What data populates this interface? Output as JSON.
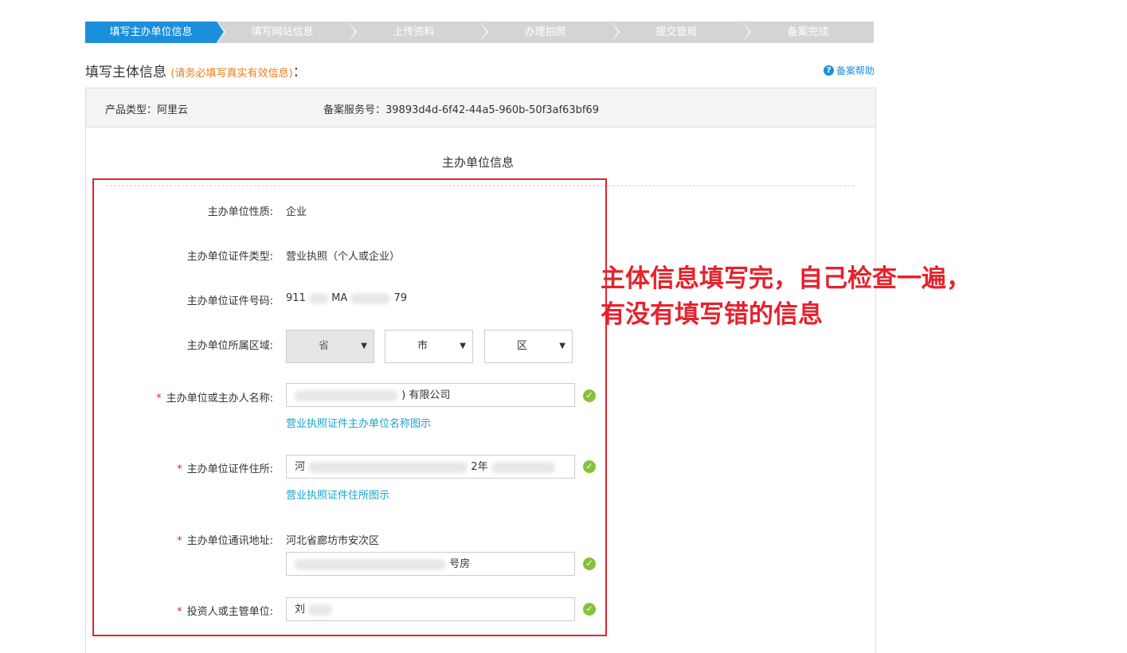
{
  "steps": [
    {
      "label": "填写主办单位信息",
      "active": true
    },
    {
      "label": "填写网站信息",
      "active": false
    },
    {
      "label": "上传资料",
      "active": false
    },
    {
      "label": "办理拍照",
      "active": false
    },
    {
      "label": "提交管局",
      "active": false
    },
    {
      "label": "备案完成",
      "active": false
    }
  ],
  "heading": {
    "title": "填写主体信息",
    "warning": "(请务必填写真实有效信息)",
    "colon": "："
  },
  "help": {
    "label": "备案帮助",
    "icon": "question-icon"
  },
  "info": {
    "product_type": "产品类型：阿里云",
    "service_number": "备案服务号：39893d4d-6f42-44a5-960b-50f3af63bf69"
  },
  "section_title": "主办单位信息",
  "form": {
    "nature_label": "主办单位性质:",
    "nature_value": "企业",
    "cert_type_label": "主办单位证件类型:",
    "cert_type_value": "营业执照（个人或企业）",
    "cert_no_label": "主办单位证件号码:",
    "cert_no_value_a": "911",
    "cert_no_value_b": "MA",
    "cert_no_value_c": "79",
    "region_label": "主办单位所属区域:",
    "province_value": "省",
    "city_value": "市",
    "district_value": "区",
    "name_label": "主办单位或主办人名称:",
    "name_value": ") 有限公司",
    "name_hint": "营业执照证件主办单位名称图示",
    "address_label": "主办单位证件住所:",
    "address_value_a": "河",
    "address_value_b": "2年",
    "address_hint": "营业执照证件住所图示",
    "mail_label": "主办单位通讯地址:",
    "mail_prefix": "河北省廊坊市安次区",
    "mail_value": "号房",
    "investor_label": "投资人或主管单位:",
    "investor_value": "刘"
  },
  "annotation": {
    "line1": "主体信息填写完，自己检查一遍，",
    "line2": "有没有填写错的信息"
  },
  "colors": {
    "accent": "#1b8fdc",
    "step_inactive": "#d4d4d4",
    "warn": "#ef7d1a",
    "annot": "#e5232d",
    "ok": "#86c23a",
    "link": "#1aa3c9"
  }
}
